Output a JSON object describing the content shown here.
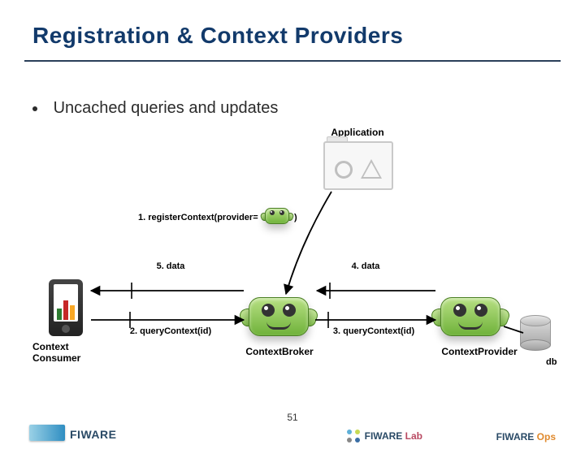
{
  "title": "Registration & Context Providers",
  "bullet": "Uncached queries and updates",
  "roles": {
    "application": "Application",
    "consumer": "Context\nConsumer",
    "broker": "ContextBroker",
    "provider": "ContextProvider",
    "db": "db"
  },
  "steps": {
    "s1_pre": "1. registerContext(provider=",
    "s1_post": ")",
    "s2": "2. queryContext(id)",
    "s3": "3. queryContext(id)",
    "s4": "4. data",
    "s5": "5. data"
  },
  "page_number": "51",
  "footer": {
    "fiware": "FIWARE",
    "lab": "FIWARE",
    "lab_suffix": "Lab",
    "ops": "FIWARE",
    "ops_suffix": "Ops"
  },
  "colors": {
    "title": "#123a6b",
    "node": "#6fb23a"
  }
}
